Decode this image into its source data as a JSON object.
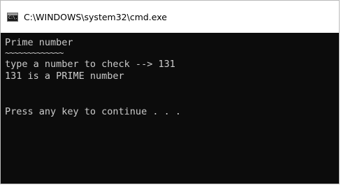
{
  "window": {
    "title": "C:\\WINDOWS\\system32\\cmd.exe",
    "icon": "cmd-console-icon",
    "icon_text": "C:\\."
  },
  "console": {
    "lines": [
      "Prime number",
      "~~~~~~~~~~~~~",
      "type a number to check --> 131",
      "131 is a PRIME number",
      "",
      "",
      "Press any key to continue . . ."
    ]
  }
}
